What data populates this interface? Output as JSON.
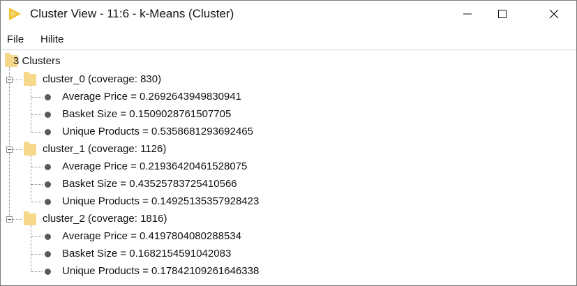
{
  "window": {
    "title": "Cluster View - 11:6 - k-Means (Cluster)"
  },
  "menu": {
    "file": "File",
    "hilite": "Hilite"
  },
  "tree": {
    "root_label": "3 Clusters",
    "clusters": [
      {
        "label": "cluster_0 (coverage: 830)",
        "children": [
          "Average Price = 0.2692643949830941",
          "Basket Size = 0.1509028761507705",
          "Unique Products = 0.5358681293692465"
        ]
      },
      {
        "label": "cluster_1 (coverage: 1126)",
        "children": [
          "Average Price = 0.21936420461528075",
          "Basket Size = 0.43525783725410566",
          "Unique Products = 0.14925135357928423"
        ]
      },
      {
        "label": "cluster_2 (coverage: 1816)",
        "children": [
          "Average Price = 0.4197804080288534",
          "Basket Size = 0.1682154591042083",
          "Unique Products = 0.17842109261646338"
        ]
      }
    ]
  },
  "icons": {
    "app": "knime-triangle-icon",
    "minimize": "minimize-icon",
    "maximize": "maximize-icon",
    "close": "close-icon",
    "folder": "folder-icon",
    "collapse": "collapse-icon",
    "leaf": "bullet-icon"
  },
  "colors": {
    "folder": "#f6d88a",
    "app_icon": "#f2c230",
    "bullet": "#5a5a5a"
  }
}
